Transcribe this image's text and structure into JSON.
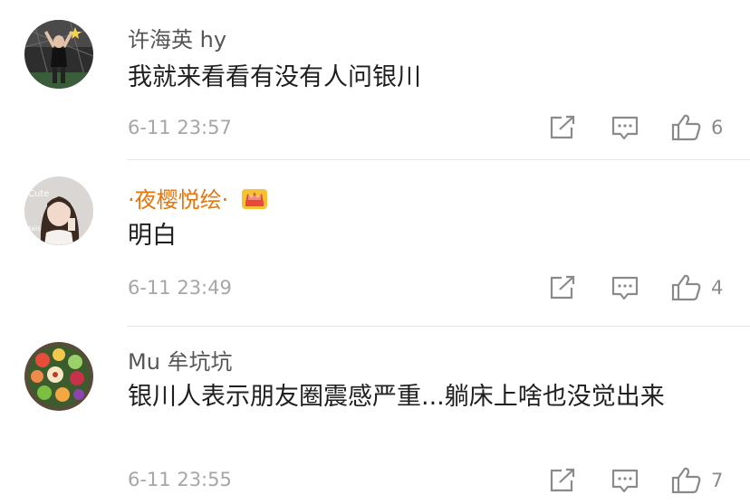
{
  "comments": [
    {
      "username": "许海英 hy",
      "text": "我就来看看有没有人问银川",
      "time": "6-11 23:57",
      "likes": "6",
      "avatar_icon": "user-photo-avatar",
      "vip": false
    },
    {
      "username": "·夜樱悦绘·",
      "text": "明白",
      "time": "6-11 23:49",
      "likes": "4",
      "avatar_icon": "user-photo-avatar",
      "vip": true,
      "badge_icon": "crown-icon",
      "name_color": "#e6760b"
    },
    {
      "username": "Mu 牟坑坑",
      "text": "银川人表示朋友圈震感严重...躺床上啥也没觉出来",
      "time": "6-11 23:55",
      "likes": "7",
      "avatar_icon": "user-photo-avatar",
      "vip": false
    }
  ],
  "icons": {
    "share": "share-icon",
    "reply": "comment-icon",
    "like": "thumbs-up-icon"
  }
}
